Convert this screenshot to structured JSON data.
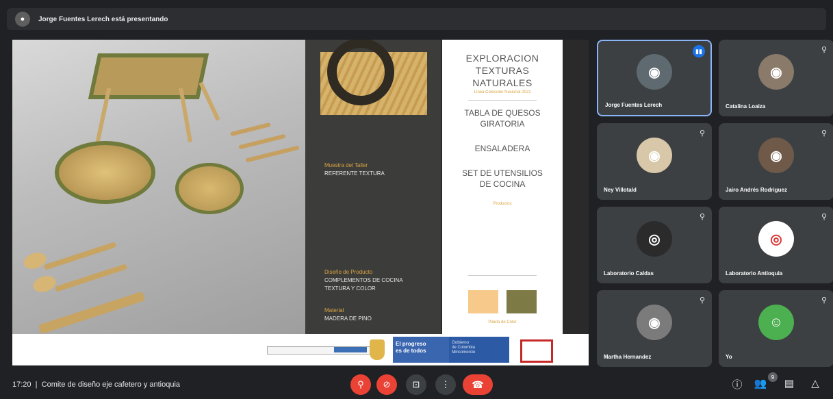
{
  "presenter": {
    "avatar_glyph": "●",
    "text": "Jorge Fuentes Lerech está presentando"
  },
  "slide": {
    "dark_panel": {
      "sample_title": "Muestra del Taller",
      "sample_value": "REFERENTE TEXTURA",
      "design_title": "Diseño de Producto",
      "design_value1": "COMPLEMENTOS DE COCINA",
      "design_value2": "TEXTURA Y COLOR",
      "material_title": "Material",
      "material_value": "MADERA DE PINO"
    },
    "white_panel": {
      "title_line1": "EXPLORACION",
      "title_line2": "TEXTURAS",
      "title_line3": "NATURALES",
      "subtitle": "Línea Colección Nacional 2021",
      "item1_line1": "TABLA DE QUESOS",
      "item1_line2": "GIRATORIA",
      "item2": "ENSALADERA",
      "item3_line1": "SET DE UTENSILIOS",
      "item3_line2": "DE COCINA",
      "products_label": "Productos",
      "palette_label": "Paleta de Color",
      "swatch1_color": "#f7c98a",
      "swatch2_color": "#7d7a45"
    },
    "banner": {
      "progress_line1": "El progreso",
      "progress_line2": "es de todos",
      "gov_line1": "Gobierno",
      "gov_line2": "de Colombia",
      "gov_line3": "Mincomercio"
    }
  },
  "participants": [
    {
      "name": "Jorge Fuentes Lerech",
      "speaking": true,
      "avatar_color": "#5f6a70",
      "glyph": "◉"
    },
    {
      "name": "Catalina Loaiza",
      "speaking": false,
      "avatar_color": "#8a7a6a",
      "glyph": "◉"
    },
    {
      "name": "Ney Villotald",
      "speaking": false,
      "avatar_color": "#d8c7a8",
      "glyph": "◉"
    },
    {
      "name": "Jairo Andrés Rodriguez",
      "speaking": false,
      "avatar_color": "#6f5a4a",
      "glyph": "◉"
    },
    {
      "name": "Laboratorio Caldas",
      "speaking": false,
      "avatar_color": "#2b2b2b",
      "glyph": "◎"
    },
    {
      "name": "Laboratorio Antioquia",
      "speaking": false,
      "avatar_color": "#ffffff",
      "glyph": "◎"
    },
    {
      "name": "Martha Hernandez",
      "speaking": false,
      "avatar_color": "#7b7b7b",
      "glyph": "◉"
    },
    {
      "name": "Yo",
      "speaking": false,
      "avatar_color": "#4caf50",
      "glyph": "☺"
    }
  ],
  "icons": {
    "mic_off": "⚲",
    "speaking": "▮▮",
    "cam_off": "⊘",
    "present": "⊡",
    "more": "⋮",
    "hangup": "☎",
    "info": "ⓘ",
    "people": "👥",
    "chat": "▤",
    "activities": "△"
  },
  "bottom": {
    "time": "17:20",
    "separator": "|",
    "meeting_name": "Comite de diseño eje cafetero y antioquia",
    "participant_count": "9"
  }
}
